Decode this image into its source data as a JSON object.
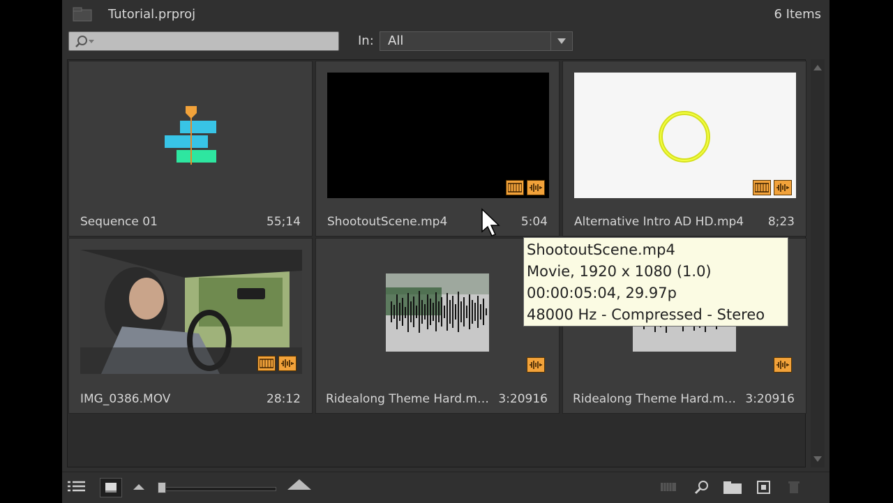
{
  "header": {
    "project_title": "Tutorial.prproj",
    "items_count": "6 Items"
  },
  "search": {
    "placeholder": ""
  },
  "filter": {
    "label": "In:",
    "value": "All"
  },
  "items": [
    {
      "name": "Sequence 01",
      "duration": "55;14",
      "type": "sequence"
    },
    {
      "name": "ShootoutScene.mp4",
      "duration": "5:04",
      "type": "video"
    },
    {
      "name": "Alternative Intro AD HD.mp4",
      "duration": "8;23",
      "type": "video"
    },
    {
      "name": "IMG_0386.MOV",
      "duration": "28:12",
      "type": "video"
    },
    {
      "name": "Ridealong Theme Hard.m…",
      "duration": "3:20916",
      "type": "audio"
    },
    {
      "name": "Ridealong Theme Hard.m…",
      "duration": "3:20916",
      "type": "audio"
    }
  ],
  "tooltip": {
    "line1": "ShootoutScene.mp4",
    "line2": "Movie, 1920 x 1080 (1.0)",
    "line3": "00:00:05:04, 29.97p",
    "line4": "48000 Hz - Compressed - Stereo"
  },
  "toolbar": {
    "icons": [
      "list-view-icon",
      "icon-view-icon",
      "zoom-out-icon",
      "zoom-slider",
      "zoom-in-icon",
      "automate-to-sequence-icon",
      "find-icon",
      "new-bin-icon",
      "new-item-icon",
      "clear-icon"
    ]
  },
  "colors": {
    "panel": "#303030",
    "badge": "#f2a23a",
    "tooltip_bg": "#fbfbe3",
    "sequence_blue": "#38c4e6",
    "sequence_green": "#2ee6a0"
  }
}
